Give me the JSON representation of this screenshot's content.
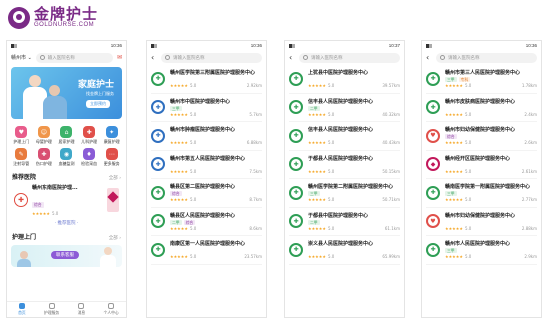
{
  "brand": {
    "name_cn": "金牌护士",
    "name_en": "GOLDNURSE.COM"
  },
  "home": {
    "status": {
      "carrier": "",
      "time": "10:36"
    },
    "city": "赣州市 ⌄",
    "search_placeholder": "输入医院名称",
    "message_label": "消息",
    "banner": {
      "title": "家庭护士",
      "subtitle": "找金牌上门服务",
      "cta": "立即预约"
    },
    "services": [
      {
        "label": "护理上门",
        "color": "#e85c8b",
        "icon": "heart-icon",
        "glyph": "♥"
      },
      {
        "label": "母婴护理",
        "color": "#f0964a",
        "icon": "baby-icon",
        "glyph": "☺"
      },
      {
        "label": "居家护理",
        "color": "#3db36a",
        "icon": "home-icon",
        "glyph": "⌂"
      },
      {
        "label": "儿科护理",
        "color": "#e0504a",
        "icon": "child-icon",
        "glyph": "✚"
      },
      {
        "label": "康复护理",
        "color": "#3c8fdc",
        "icon": "rehab-icon",
        "glyph": "✦"
      },
      {
        "label": "注射导管",
        "color": "#e87b3e",
        "icon": "injection-icon",
        "glyph": "✎"
      },
      {
        "label": "伤口护理",
        "color": "#d94f72",
        "icon": "wound-icon",
        "glyph": "✚"
      },
      {
        "label": "血糖监测",
        "color": "#3fa8c9",
        "icon": "glucose-icon",
        "glyph": "◉"
      },
      {
        "label": "检验采血",
        "color": "#8a5cd6",
        "icon": "blood-icon",
        "glyph": "♦"
      },
      {
        "label": "更多服务",
        "color": "#e0504a",
        "icon": "more-icon",
        "glyph": "⋯"
      }
    ],
    "recommend": {
      "title": "推荐医院",
      "more": "全部 ›",
      "hospital": "赣州东南医院护理...",
      "tag": "综合",
      "stars": "★★★★★",
      "score": "5.0"
    },
    "more_hospitals": "· 推荐医院 ·",
    "care": {
      "title": "护理上门",
      "more": "全部 ›",
      "button": "联系客服"
    },
    "tabs": [
      "首页",
      "护理服务",
      "消息",
      "个人中心"
    ]
  },
  "search_placeholder": "请输入医院名称",
  "list_pages": [
    {
      "status_time": "10:36",
      "hospitals": [
        {
          "name": "赣州医学院第三附属医院护理服务中心",
          "tags": [],
          "stars": "★★★★★",
          "score": "5.0",
          "dist": "2.92km",
          "logo": "#2e9e55",
          "glyph": "✚"
        },
        {
          "name": "赣州市中医院护理服务中心",
          "tags": [
            {
              "t": "三甲",
              "c": "t-ai"
            }
          ],
          "stars": "★★★★★",
          "score": "5.0",
          "dist": "5.7km",
          "logo": "#2f6fbf",
          "glyph": "✚"
        },
        {
          "name": "赣州市肿瘤医院护理服务中心",
          "tags": [],
          "stars": "★★★★★",
          "score": "5.0",
          "dist": "6.88km",
          "logo": "#2f6fbf",
          "glyph": "✚"
        },
        {
          "name": "赣州市第五人民医院护理服务中心",
          "tags": [],
          "stars": "★★★★★",
          "score": "5.0",
          "dist": "7.5km",
          "logo": "#2f6fbf",
          "glyph": "✚"
        },
        {
          "name": "赣县区第二医院护理服务中心",
          "tags": [
            {
              "t": "综合",
              "c": "t-zh"
            }
          ],
          "stars": "★★★★★",
          "score": "5.0",
          "dist": "8.7km",
          "logo": "#2e9e55",
          "glyph": "✚"
        },
        {
          "name": "赣县区人民医院护理服务中心",
          "tags": [
            {
              "t": "二甲",
              "c": "t-ai"
            },
            {
              "t": "综合",
              "c": "t-zh"
            }
          ],
          "stars": "★★★★★",
          "score": "5.0",
          "dist": "8.6km",
          "logo": "#2e9e55",
          "glyph": "✚"
        },
        {
          "name": "南康区第一人民医院护理服务中心",
          "tags": [],
          "stars": "★★★★★",
          "score": "5.0",
          "dist": "23.57km",
          "logo": "#2e9e55",
          "glyph": "✚"
        }
      ]
    },
    {
      "status_time": "10:37",
      "hospitals": [
        {
          "name": "上犹县中医院护理服务中心",
          "tags": [],
          "stars": "★★★★★",
          "score": "5.0",
          "dist": "39.57km",
          "logo": "#2e9e55",
          "glyph": "✚"
        },
        {
          "name": "信丰县人民医院护理服务中心",
          "tags": [
            {
              "t": "二甲",
              "c": "t-ai"
            }
          ],
          "stars": "★★★★★",
          "score": "5.0",
          "dist": "40.32km",
          "logo": "#2e9e55",
          "glyph": "✚"
        },
        {
          "name": "信丰县人民医院护理服务中心",
          "tags": [],
          "stars": "★★★★★",
          "score": "5.0",
          "dist": "40.43km",
          "logo": "#2e9e55",
          "glyph": "✚"
        },
        {
          "name": "于都县人民医院护理服务中心",
          "tags": [],
          "stars": "★★★★★",
          "score": "5.0",
          "dist": "50.15km",
          "logo": "#2e9e55",
          "glyph": "✚"
        },
        {
          "name": "赣州医学院第二附属医院护理服务中心",
          "tags": [
            {
              "t": "三甲",
              "c": "t-ai"
            }
          ],
          "stars": "★★★★★",
          "score": "5.0",
          "dist": "50.71km",
          "logo": "#2e9e55",
          "glyph": "✚"
        },
        {
          "name": "于都县中医院护理服务中心",
          "tags": [
            {
              "t": "二甲",
              "c": "t-ai"
            }
          ],
          "stars": "★★★★★",
          "score": "5.0",
          "dist": "61.1km",
          "logo": "#2e9e55",
          "glyph": "✚"
        },
        {
          "name": "崇义县人民医院护理服务中心",
          "tags": [],
          "stars": "★★★★★",
          "score": "5.0",
          "dist": "65.99km",
          "logo": "#2e9e55",
          "glyph": "✚"
        }
      ]
    },
    {
      "status_time": "10:36",
      "hospitals": [
        {
          "name": "赣州市第三人民医院护理服务中心",
          "tags": [
            {
              "t": "三甲",
              "c": "t-ai"
            },
            {
              "t": "专科",
              "c": "t-zk"
            }
          ],
          "stars": "★★★★★",
          "score": "5.0",
          "dist": "1.78km",
          "logo": "#2e9e55",
          "glyph": "✚"
        },
        {
          "name": "赣州市皮肤病医院护理服务中心",
          "tags": [],
          "stars": "★★★★★",
          "score": "5.0",
          "dist": "2.4km",
          "logo": "#2e9e55",
          "glyph": "✚"
        },
        {
          "name": "赣州市妇幼保健院护理服务中心",
          "tags": [
            {
              "t": "综合",
              "c": "t-zh"
            }
          ],
          "stars": "★★★★★",
          "score": "5.0",
          "dist": "2.6km",
          "logo": "#e0504a",
          "glyph": "♥"
        },
        {
          "name": "赣州经开区医院护理服务中心",
          "tags": [],
          "stars": "★★★★★",
          "score": "5.0",
          "dist": "2.61km",
          "logo": "#c2185b",
          "glyph": "◆"
        },
        {
          "name": "赣南医学院第一附属医院护理服务中心",
          "tags": [
            {
              "t": "三甲",
              "c": "t-ai"
            }
          ],
          "stars": "★★★★★",
          "score": "5.0",
          "dist": "2.77km",
          "logo": "#2e9e55",
          "glyph": "✚"
        },
        {
          "name": "赣州市妇幼保健院护理服务中心",
          "tags": [],
          "stars": "★★★★★",
          "score": "5.0",
          "dist": "2.88km",
          "logo": "#e0504a",
          "glyph": "♥"
        },
        {
          "name": "赣州市人民医院护理服务中心",
          "tags": [
            {
              "t": "三甲",
              "c": "t-ai"
            }
          ],
          "stars": "★★★★★",
          "score": "5.0",
          "dist": "2.9km",
          "logo": "#2e9e55",
          "glyph": "✚"
        }
      ]
    }
  ]
}
